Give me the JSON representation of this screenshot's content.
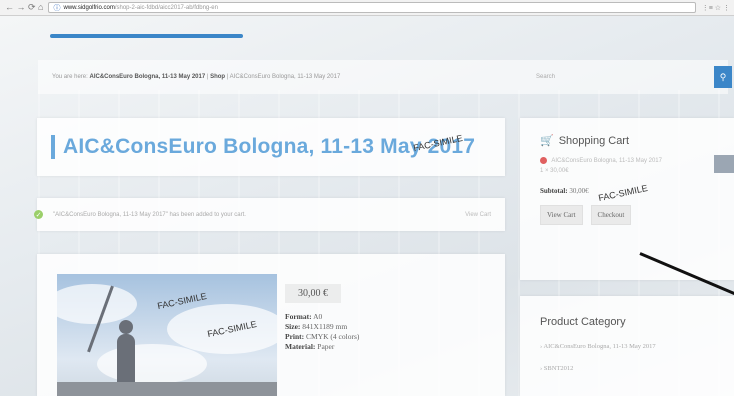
{
  "browser": {
    "nav_icons": "← → ⟳ ⌂",
    "url_prefix": "ⓘ",
    "url_host": "www.sidgolfrio.com",
    "url_path": "/shop-2-aic-fdbd/aicc2017-ab/fdbng-en",
    "right_icons": "⋮≡ ☆ ⋮"
  },
  "breadcrumb": {
    "prefix": "You are here: ",
    "link1": "AIC&ConsEuro Bologna, 11-13 May 2017",
    "sep1": " | ",
    "link2": "Shop",
    "sep2": " | ",
    "current": "AIC&ConsEuro Bologna, 11-13 May 2017"
  },
  "search": {
    "placeholder": "Search",
    "icon": "search-icon"
  },
  "page": {
    "title": "AIC&ConsEuro Bologna, 11-13 May 2017",
    "watermark": "FAC-SIMILE"
  },
  "notice": {
    "message": "\"AIC&ConsEuro Bologna, 11-13 May 2017\" has been added to your cart.",
    "view_cart": "View Cart"
  },
  "product": {
    "price": "30,00 €",
    "specs": [
      {
        "label": "Format:",
        "value": " A0"
      },
      {
        "label": "Size:",
        "value": " 841X1189 mm"
      },
      {
        "label": "Print:",
        "value": " CMYK (4 colors)"
      },
      {
        "label": "Material:",
        "value": " Paper"
      }
    ]
  },
  "cart": {
    "title": "Shopping Cart",
    "item_name": "AIC&ConsEuro Bologna, 11-13 May 2017",
    "quantity": "1 × 30,00€",
    "subtotal_label": "Subtotal:",
    "subtotal_value": " 30,00€",
    "view_cart": "View Cart",
    "checkout": "Checkout"
  },
  "category": {
    "title": "Product Category",
    "items": [
      "AIC&ConsEuro Bologna, 11-13 May 2017",
      "SBNT2012"
    ]
  },
  "colors": {
    "accent": "#3b86c8",
    "title": "#6aa9dc",
    "success": "#9bcf6a",
    "remove": "#e06060"
  }
}
